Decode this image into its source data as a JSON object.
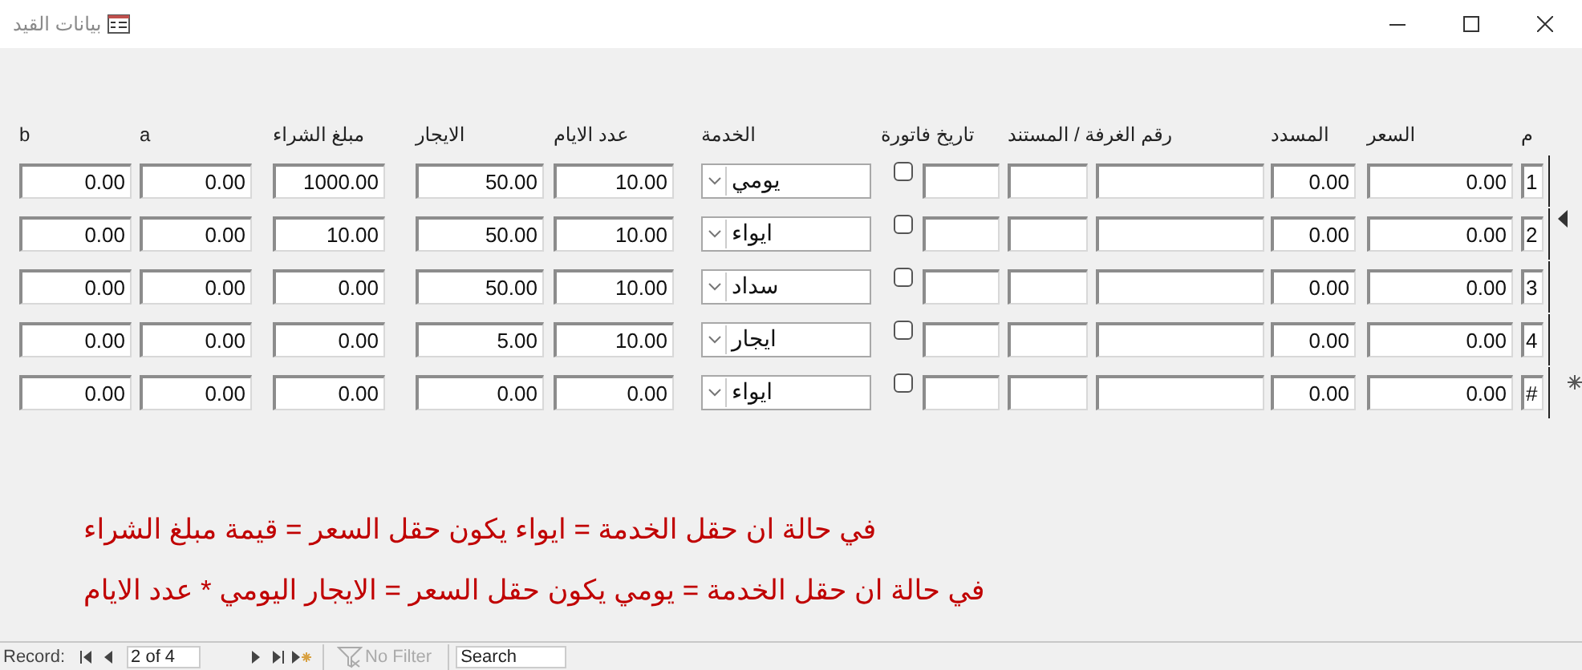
{
  "window": {
    "title": "بيانات القيد"
  },
  "columns": [
    {
      "label": "م"
    },
    {
      "label": "السعر"
    },
    {
      "label": "المسدد"
    },
    {},
    {
      "label": "رقم الغرفة / المستند"
    },
    {},
    {
      "label": "تاريخ فاتورة"
    },
    {
      "label": "الخدمة"
    },
    {
      "label": "عدد الايام"
    },
    {
      "label": "الايجار"
    },
    {
      "label": "مبلغ الشراء"
    },
    {
      "label": "a"
    },
    {
      "label": "b"
    }
  ],
  "rows": [
    {
      "kind": "record",
      "selected": false,
      "number": "1",
      "price": "0.00",
      "paid": "0.00",
      "checked": false,
      "service": "يومي",
      "days": "10.00",
      "rent": "50.00",
      "purchase": "1000.00",
      "a": "0.00",
      "b": "0.00"
    },
    {
      "kind": "record",
      "selected": true,
      "number": "2",
      "price": "0.00",
      "paid": "0.00",
      "checked": false,
      "service": "ايواء",
      "days": "10.00",
      "rent": "50.00",
      "purchase": "10.00",
      "a": "0.00",
      "b": "0.00"
    },
    {
      "kind": "record",
      "selected": false,
      "number": "3",
      "price": "0.00",
      "paid": "0.00",
      "checked": false,
      "service": "سداد",
      "days": "10.00",
      "rent": "50.00",
      "purchase": "0.00",
      "a": "0.00",
      "b": "0.00"
    },
    {
      "kind": "record",
      "selected": false,
      "number": "4",
      "price": "0.00",
      "paid": "0.00",
      "checked": false,
      "service": "ايجار",
      "days": "10.00",
      "rent": "5.00",
      "purchase": "0.00",
      "a": "0.00",
      "b": "0.00"
    },
    {
      "kind": "new",
      "selected": false,
      "number": "#",
      "price": "0.00",
      "paid": "0.00",
      "checked": false,
      "service": "ايواء",
      "days": "0.00",
      "rent": "0.00",
      "purchase": "0.00",
      "a": "0.00",
      "b": "0.00"
    }
  ],
  "notes": [
    "في حالة  ان حقل الخدمة = ايواء يكون حقل السعر = قيمة مبلغ الشراء",
    "في حالة  ان حقل الخدمة = يومي  يكون حقل السعر = الايجار اليومي * عدد الايام"
  ],
  "status_bar": {
    "record_label": "Record:",
    "position": "2 of 4",
    "filter": "No Filter",
    "search": {
      "placeholder": "Search"
    }
  }
}
